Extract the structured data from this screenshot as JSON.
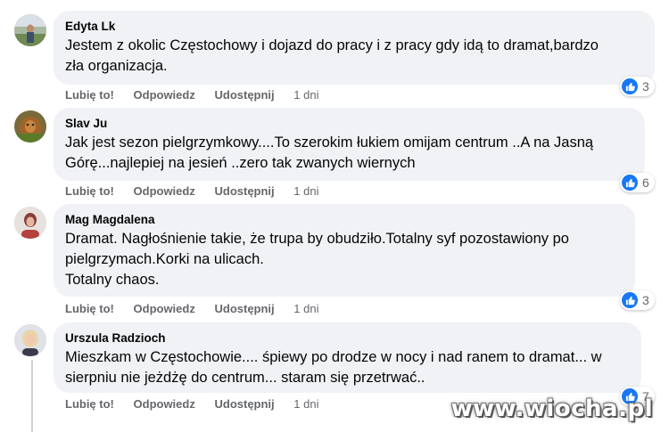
{
  "comments": [
    {
      "author": "Edyta Lk",
      "text_lines": [
        "Jestem z okolic Częstochowy i dojazd do pracy i z pracy gdy idą to dramat,bardzo",
        "zła organizacja."
      ],
      "actions": {
        "like": "Lubię to!",
        "reply": "Odpowiedz",
        "share": "Udostępnij",
        "time": "1 dni"
      },
      "reactions": {
        "icon": "thumbs-up-icon",
        "count": "3"
      }
    },
    {
      "author": "Slav Ju",
      "text_lines": [
        "Jak jest sezon pielgrzymkowy....To szerokim łukiem omijam centrum ..A na Jasną",
        "Górę...najlepiej na jesień ..zero tak zwanych wiernych"
      ],
      "actions": {
        "like": "Lubię to!",
        "reply": "Odpowiedz",
        "share": "Udostępnij",
        "time": "1 dni"
      },
      "reactions": {
        "icon": "thumbs-up-icon",
        "count": "6"
      }
    },
    {
      "author": "Mag Magdalena",
      "text_lines": [
        "Dramat. Nagłośnienie takie, że trupa by obudziło.Totalny syf pozostawiony po",
        "pielgrzymach.Korki na ulicach.",
        "Totalny chaos."
      ],
      "actions": {
        "like": "Lubię to!",
        "reply": "Odpowiedz",
        "share": "Udostępnij",
        "time": "1 dni"
      },
      "reactions": {
        "icon": "thumbs-up-icon",
        "count": "3"
      }
    },
    {
      "author": "Urszula Radzioch",
      "text_lines": [
        "Mieszkam w Częstochowie.... śpiewy po drodze w nocy i nad ranem to dramat... w",
        "sierpniu nie jeżdżę do centrum... staram się przetrwać.."
      ],
      "actions": {
        "like": "Lubię to!",
        "reply": "Odpowiedz",
        "share": "Udostępnij",
        "time": "1 dni"
      },
      "reactions": {
        "icon": "thumbs-up-icon",
        "count": "7"
      }
    }
  ],
  "watermark": "www.wiocha.pl",
  "colors": {
    "bubble": "#f0f2f5",
    "like_blue": "#1877f2",
    "meta_gray": "#65676b"
  }
}
